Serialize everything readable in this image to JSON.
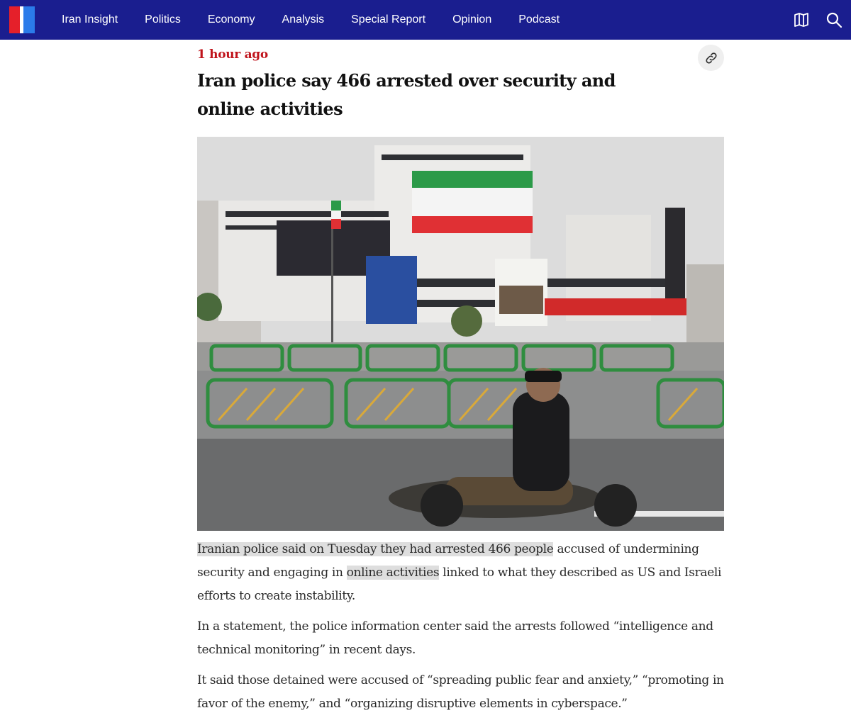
{
  "nav": {
    "items": [
      "Iran Insight",
      "Politics",
      "Economy",
      "Analysis",
      "Special Report",
      "Opinion",
      "Podcast"
    ],
    "icons": [
      "map-icon",
      "search-icon"
    ],
    "colors": {
      "background": "#1a1e8f",
      "logo_red": "#e5202a",
      "logo_blue": "#2b7bea"
    }
  },
  "article": {
    "timestamp": "1 hour ago",
    "headline": "Iran police say 466 arrested over security and online activities",
    "share_icon": "link-icon",
    "image_alt_icon": "news-photo",
    "paragraphs": {
      "p1_highlight1": "Iranian police said on Tuesday they had arrested 466 people",
      "p1_text1": " accused of undermining security and engaging in ",
      "p1_highlight2": "online activities",
      "p1_text2": " linked to what they described as US and Israeli efforts to create instability.",
      "p2": "In a statement, the police information center said the arrests followed “intelligence and technical monitoring” in recent days.",
      "p3": "It said those detained were accused of “spreading public fear and anxiety,” “promoting in favor of the enemy,” and “organizing disruptive elements in cyberspace.”"
    },
    "colors": {
      "timestamp": "#c0141c",
      "highlight": "#dedede"
    }
  }
}
